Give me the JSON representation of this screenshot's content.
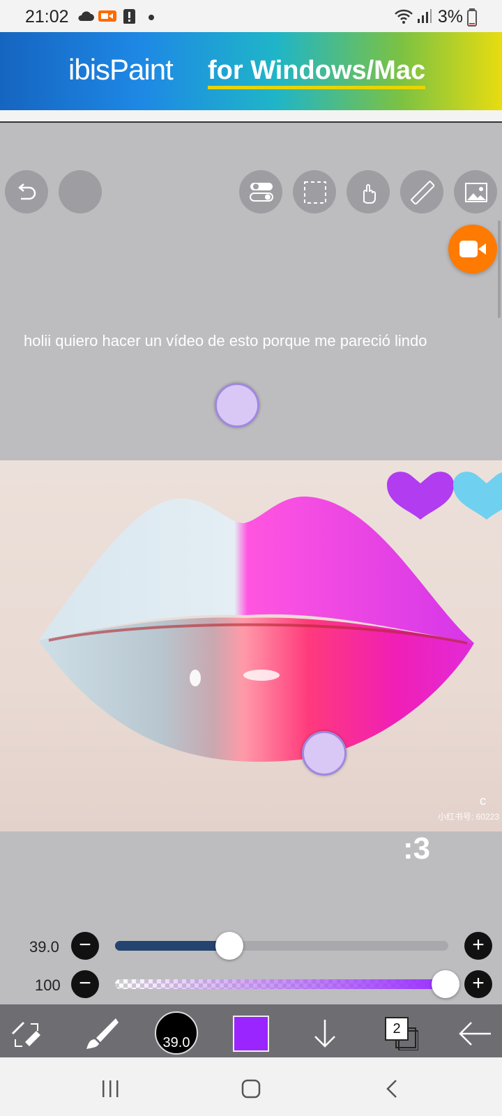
{
  "status_bar": {
    "time": "21:02",
    "battery": "3%",
    "icons": [
      "cloud-icon",
      "video-camera-icon",
      "alert-icon",
      "dot-icon",
      "wifi-icon",
      "signal-icon",
      "battery-icon"
    ]
  },
  "banner": {
    "logo": "ibisPaint",
    "tagline": "for Windows/Mac"
  },
  "top_tools": [
    "undo-icon",
    "blank-button",
    "toggle-icon",
    "selection-icon",
    "hand-icon",
    "ruler-icon",
    "image-icon"
  ],
  "canvas": {
    "note_text": "holii quiero hacer un vídeo de esto porque me pareció lindo",
    "caption": ":3",
    "watermark_letter": "c",
    "watermark_id": "小红书号: 60223"
  },
  "brush_size_slider": {
    "value_label": "39.0",
    "value": 39.0
  },
  "opacity_slider": {
    "value_label": "100",
    "value": 100
  },
  "bottom_toolbar": {
    "brush_size_label": "39.0",
    "color": "#9a25ff",
    "layer_count": "2"
  },
  "colors": {
    "accent_record": "#ff7a00",
    "slider_fill": "#24436e"
  }
}
